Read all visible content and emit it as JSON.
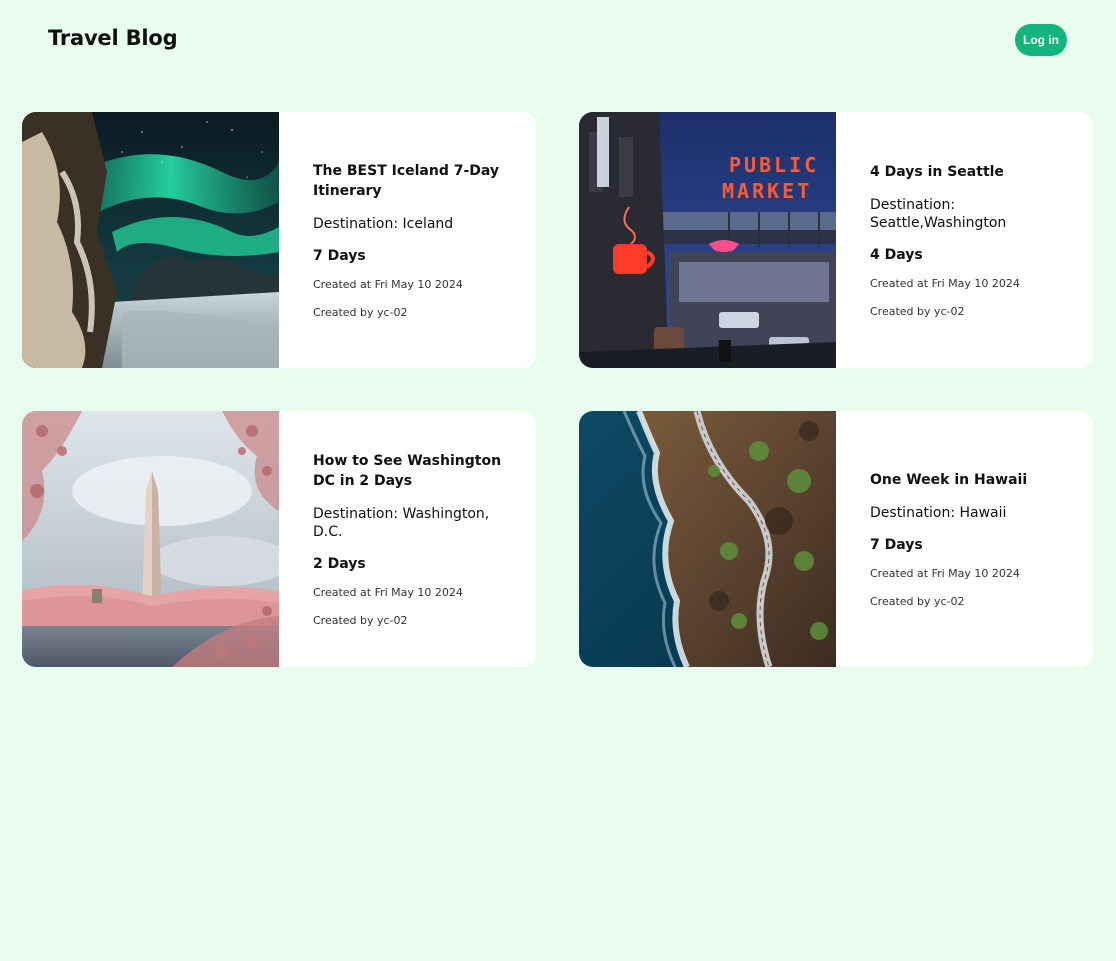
{
  "header": {
    "brand": "Travel Blog",
    "login_label": "Log in"
  },
  "colors": {
    "background": "#e8fcf0",
    "accent": "#12b57b",
    "card": "#ffffff"
  },
  "posts": [
    {
      "title": "The BEST Iceland 7-Day Itinerary",
      "destination": "Destination: Iceland",
      "days": "7 Days",
      "created_at": "Created at Fri May 10 2024",
      "created_by": "Created by yc-02",
      "image": "iceland-aurora-photo"
    },
    {
      "title": "4 Days in Seattle",
      "destination": "Destination: Seattle,Washington",
      "days": "4 Days",
      "created_at": "Created at Fri May 10 2024",
      "created_by": "Created by yc-02",
      "image": "seattle-public-market-photo"
    },
    {
      "title": "How to See Washington DC in 2 Days",
      "destination": "Destination: Washington, D.C.",
      "days": "2 Days",
      "created_at": "Created at Fri May 10 2024",
      "created_by": "Created by yc-02",
      "image": "washington-monument-photo"
    },
    {
      "title": "One Week in Hawaii",
      "destination": "Destination: Hawaii",
      "days": "7 Days",
      "created_at": "Created at Fri May 10 2024",
      "created_by": "Created by yc-02",
      "image": "hawaii-coast-road-photo"
    }
  ],
  "photo_text": {
    "public": "PUBLIC",
    "market": "MARKET"
  }
}
